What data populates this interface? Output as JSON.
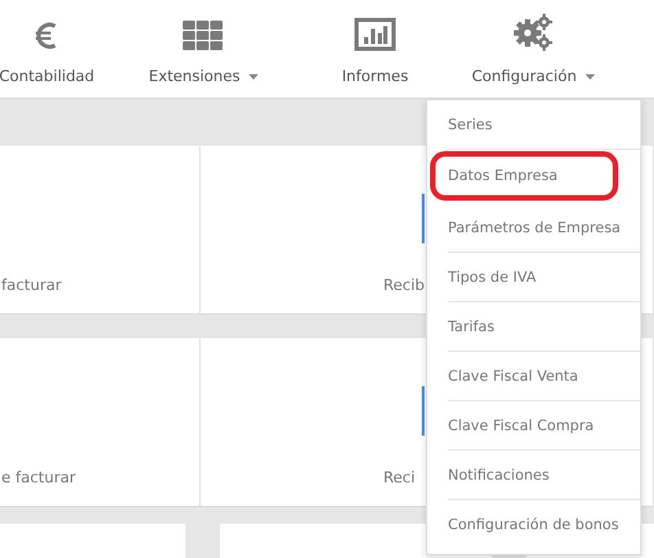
{
  "nav": [
    {
      "label": "Contabilidad",
      "dropdown": false
    },
    {
      "label": "Extensiones",
      "dropdown": true
    },
    {
      "label": "Informes",
      "dropdown": false
    },
    {
      "label": "Configuración",
      "dropdown": true
    }
  ],
  "cards": [
    {
      "label": "facturar"
    },
    {
      "label": "Recib"
    },
    {
      "label": "e facturar"
    },
    {
      "label": "Reci"
    }
  ],
  "menu": {
    "items": [
      {
        "label": "Series",
        "highlighted": false
      },
      {
        "label": "Datos Empresa",
        "highlighted": true
      },
      {
        "label": "Parámetros de Empresa",
        "highlighted": false
      },
      {
        "label": "Tipos de IVA",
        "highlighted": false
      },
      {
        "label": "Tarifas",
        "highlighted": false
      },
      {
        "label": "Clave Fiscal Venta",
        "highlighted": false
      },
      {
        "label": "Clave Fiscal Compra",
        "highlighted": false
      },
      {
        "label": "Notificaciones",
        "highlighted": false
      },
      {
        "label": "Configuración de bonos",
        "highlighted": false
      }
    ]
  }
}
